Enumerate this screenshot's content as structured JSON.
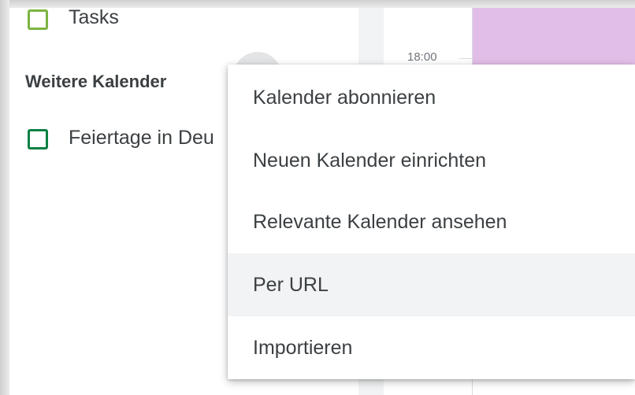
{
  "sidebar": {
    "my_calendars": [
      {
        "label": "Tasks",
        "color": "#7cb342"
      }
    ],
    "other_calendars_heading": "Weitere Kalender",
    "other_calendars": [
      {
        "label": "Feiertage in Deu",
        "color": "#0b8043"
      }
    ]
  },
  "calendar_grid": {
    "time_label": "18:00",
    "event_color": "#e1bee7"
  },
  "menu": {
    "items": [
      {
        "label": "Kalender abonnieren"
      },
      {
        "label": "Neuen Kalender einrichten"
      },
      {
        "label": "Relevante Kalender ansehen"
      },
      {
        "label": "Per URL",
        "highlighted": true
      },
      {
        "label": "Importieren"
      }
    ]
  }
}
